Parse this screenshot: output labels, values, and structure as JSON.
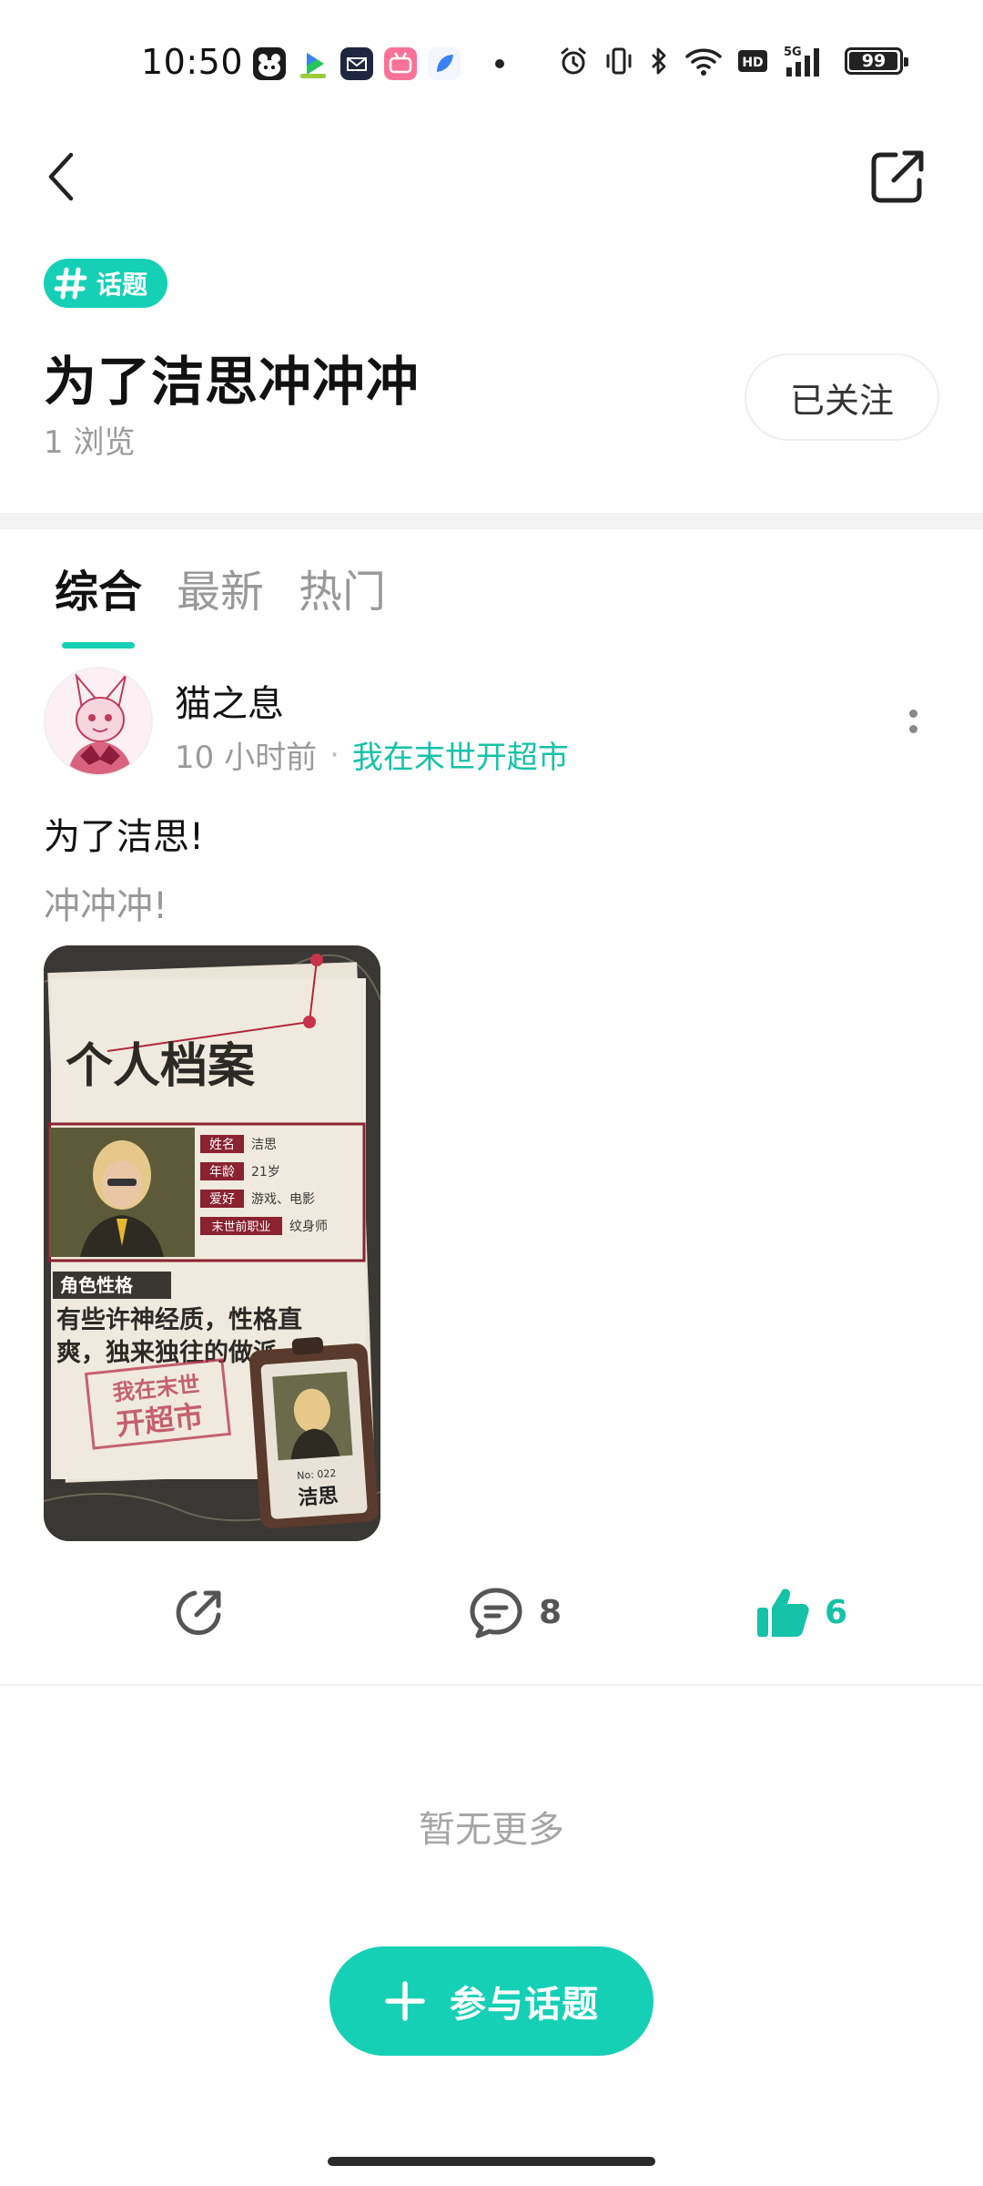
{
  "status_bar": {
    "time": "10:50",
    "battery": "99",
    "battery_level_percent": 99,
    "network_label": "5G",
    "hd_label": "HD"
  },
  "nav": {
    "back_icon": "chevron-left-icon",
    "share_icon": "external-share-icon"
  },
  "topic": {
    "tag_label": "话题",
    "title": "为了洁思冲冲冲",
    "views": "1 浏览",
    "follow_label": "已关注"
  },
  "tabs": [
    {
      "label": "综合",
      "active": true
    },
    {
      "label": "最新",
      "active": false
    },
    {
      "label": "热门",
      "active": false
    }
  ],
  "post": {
    "author": "猫之息",
    "time": "10 小时前",
    "separator": "·",
    "source": "我在末世开超市",
    "title": "为了洁思!",
    "body": "冲冲冲!",
    "image": {
      "heading": "个人档案",
      "fields": [
        {
          "label": "姓名",
          "value": "洁思"
        },
        {
          "label": "年龄",
          "value": "21岁"
        },
        {
          "label": "爱好",
          "value": "游戏、电影"
        },
        {
          "label": "末世前职业",
          "value": "纹身师"
        }
      ],
      "trait_label": "角色性格",
      "trait_text_1": "有些许神经质，性格直",
      "trait_text_2": "爽，独来独往的做派",
      "stamp_line_1": "我在末世",
      "stamp_line_2": "开超市",
      "badge_number": "No: 022",
      "badge_name": "洁思"
    },
    "comment_count": "8",
    "like_count": "6"
  },
  "footer": {
    "no_more": "暂无更多",
    "join_label": "参与话题"
  },
  "colors": {
    "accent": "#16d0b6",
    "accent_text": "#16c2a8"
  }
}
